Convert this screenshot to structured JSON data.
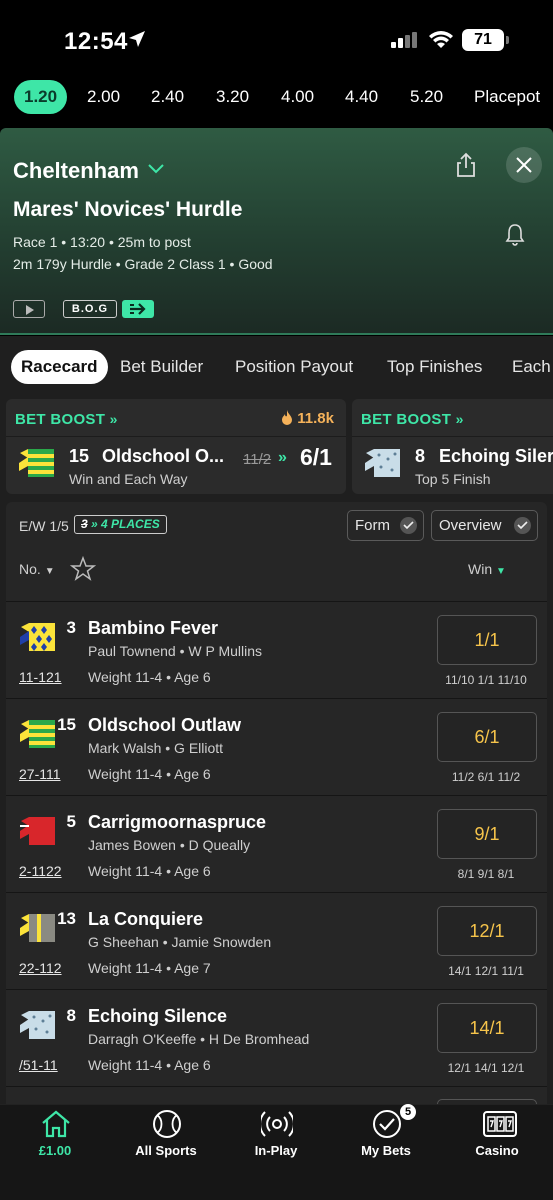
{
  "status_bar": {
    "time": "12:54",
    "battery": "71"
  },
  "time_tabs": [
    "1.20",
    "2.00",
    "2.40",
    "3.20",
    "4.00",
    "4.40",
    "5.20",
    "Placepot"
  ],
  "race": {
    "course": "Cheltenham",
    "name": "Mares' Novices' Hurdle",
    "meta1": "Race 1 • 13:20 • 25m to post",
    "meta2": "2m 179y Hurdle  • Grade 2 Class 1  • Good",
    "bog_label": "B.O.G"
  },
  "sub_tabs": [
    "Racecard",
    "Bet Builder",
    "Position Payout",
    "Top Finishes",
    "Each"
  ],
  "boosts": [
    {
      "heading": "BET BOOST",
      "count": "11.8k",
      "number": "15",
      "horse": "Oldschool O...",
      "subtitle": "Win and Each Way",
      "old_odds": "11/2",
      "new_odds": "6/1"
    },
    {
      "heading": "BET BOOST",
      "number": "8",
      "horse": "Echoing Siler",
      "subtitle": "Top 5 Finish"
    }
  ],
  "runners_panel": {
    "ew_label": "E/W 1/5",
    "places_old": "3",
    "places_new": "4 PLACES",
    "form_label": "Form",
    "overview_label": "Overview",
    "no_label": "No.",
    "win_label": "Win"
  },
  "runners": [
    {
      "number": "3",
      "name": "Bambino Fever",
      "jockey_trainer": "Paul Townend • W P Mullins",
      "form": "11-121",
      "weight_age": "Weight 11-4 • Age 6",
      "odds": "1/1",
      "history": "11/10  1/1  11/10",
      "silk": "yellow-blue-diamonds"
    },
    {
      "number": "15",
      "name": "Oldschool Outlaw",
      "jockey_trainer": "Mark Walsh • G Elliott",
      "form": "27-111",
      "weight_age": "Weight 11-4 • Age 6",
      "odds": "6/1",
      "history": "11/2  6/1  11/2",
      "silk": "green-yellow-hoops"
    },
    {
      "number": "5",
      "name": "Carrigmoornaspruce",
      "jockey_trainer": "James Bowen • D Queally",
      "form": "2-1122",
      "weight_age": "Weight 11-4 • Age 6",
      "odds": "9/1",
      "history": "8/1  9/1  8/1",
      "silk": "red"
    },
    {
      "number": "13",
      "name": "La Conquiere",
      "jockey_trainer": "G Sheehan • Jamie Snowden",
      "form": "22-112",
      "weight_age": "Weight 11-4 • Age 7",
      "odds": "12/1",
      "history": "14/1  12/1  11/1",
      "silk": "grey-yellow"
    },
    {
      "number": "8",
      "name": "Echoing Silence",
      "jockey_trainer": "Darragh O'Keeffe • H De Bromhead",
      "form": "/51-11",
      "weight_age": "Weight 11-4 • Age 6",
      "odds": "14/1",
      "history": "12/1  14/1  12/1",
      "silk": "light-blue-spots"
    }
  ],
  "bottom_nav": [
    {
      "label": "£1.00",
      "icon": "home-icon",
      "active": true
    },
    {
      "label": "All Sports",
      "icon": "ball-icon"
    },
    {
      "label": "In-Play",
      "icon": "live-icon"
    },
    {
      "label": "My Bets",
      "icon": "check-circle-icon",
      "badge": "5"
    },
    {
      "label": "Casino",
      "icon": "slots-icon"
    }
  ],
  "colors": {
    "accent": "#3ee6a7",
    "odds": "#f6c44b",
    "boost_count": "#f5b25a"
  }
}
